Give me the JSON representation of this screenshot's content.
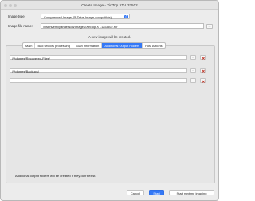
{
  "window": {
    "title": "Create Image - XinTop XT-U33502"
  },
  "form": {
    "image_type_label": "Image type:",
    "image_type_value": "Compressed Image (R-Drive Image compatible)",
    "image_file_name_label": "Image file name:",
    "image_file_name_value": "/Users/emilyanderson/Images/XinTop XT-U33502.rdr",
    "browse_label": "...",
    "info_text": "A new image will be created."
  },
  "tabs": [
    {
      "label": "Main",
      "active": false
    },
    {
      "label": "Bad sectors processing",
      "active": false
    },
    {
      "label": "Scan Information",
      "active": false
    },
    {
      "label": "Additional Output Folders",
      "active": true
    },
    {
      "label": "Post Actions",
      "active": false
    }
  ],
  "output_folders": {
    "rows": [
      {
        "path": "/Volumes/Recovered-Files/"
      },
      {
        "path": "/Volumes/Backups/"
      },
      {
        "path": ""
      }
    ],
    "browse_label": "...",
    "note": "Additional output folders will be created if they don't exist."
  },
  "footer": {
    "cancel_label": "Cancel",
    "start_label": "Start",
    "start_runtime_label": "Start runtime imaging"
  },
  "colors": {
    "accent": "#3478f6",
    "delete_x": "#c0392b"
  }
}
